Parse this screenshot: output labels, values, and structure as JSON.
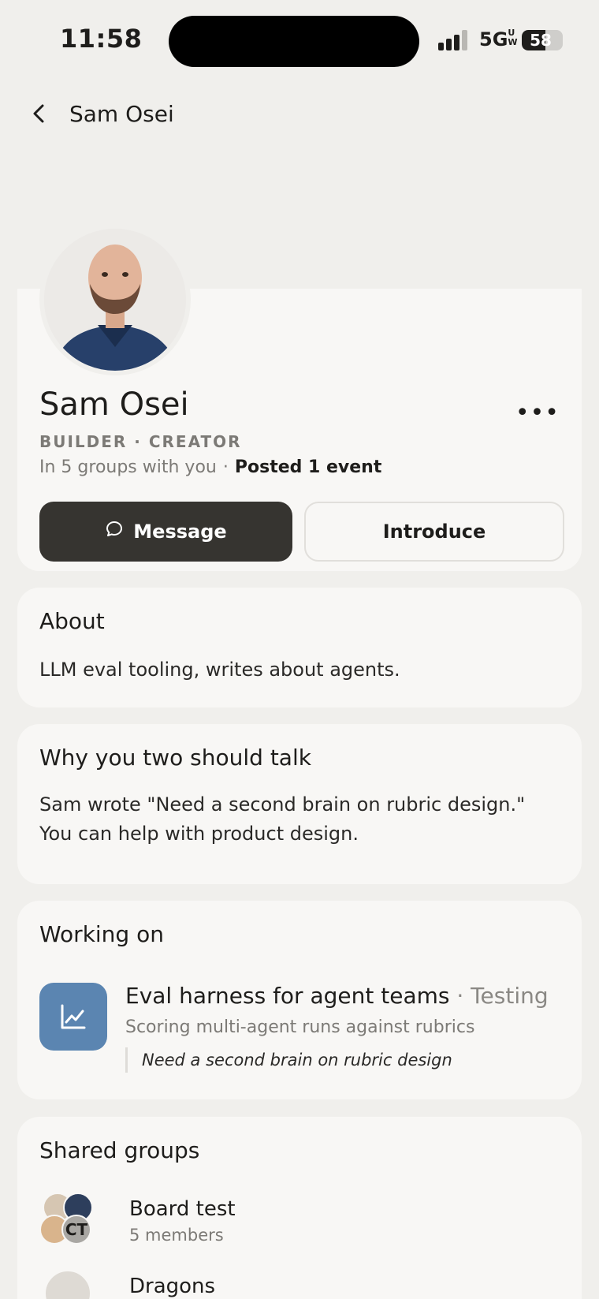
{
  "status_bar": {
    "time": "11:58",
    "network": "5G",
    "network_suffix": "UW",
    "battery_percent": "58",
    "battery_level": 0.58
  },
  "nav": {
    "back_icon": "chevron-left-icon",
    "title": "Sam Osei"
  },
  "profile": {
    "name": "Sam Osei",
    "roles": "BUILDER · CREATOR",
    "groups_in_common": "In 5 groups with you",
    "separator": "·",
    "events_posted": "Posted 1 event",
    "more_label": "•••",
    "message_button": "Message",
    "message_icon": "chat-bubble-icon",
    "introduce_button": "Introduce"
  },
  "about": {
    "heading": "About",
    "text": "LLM eval tooling, writes about agents."
  },
  "why_talk": {
    "heading": "Why you two should talk",
    "text": "Sam wrote \"Need a second brain on rubric design.\" You can help with product design."
  },
  "working_on": {
    "heading": "Working on",
    "project": {
      "icon": "line-chart-icon",
      "icon_color": "#5b85b1",
      "title": "Eval harness for agent teams",
      "status": " · Testing",
      "subtitle": "Scoring multi-agent runs against rubrics",
      "need": "Need a second brain on rubric design"
    }
  },
  "shared_groups": {
    "heading": "Shared groups",
    "groups": [
      {
        "name": "Board test",
        "members": "5 members",
        "initials": "CT"
      },
      {
        "name": "Dragons",
        "members": ""
      }
    ]
  },
  "colors": {
    "background": "#f0efec",
    "card": "#f8f7f5",
    "primary_button": "#363430",
    "muted_text": "#7c7a76"
  }
}
